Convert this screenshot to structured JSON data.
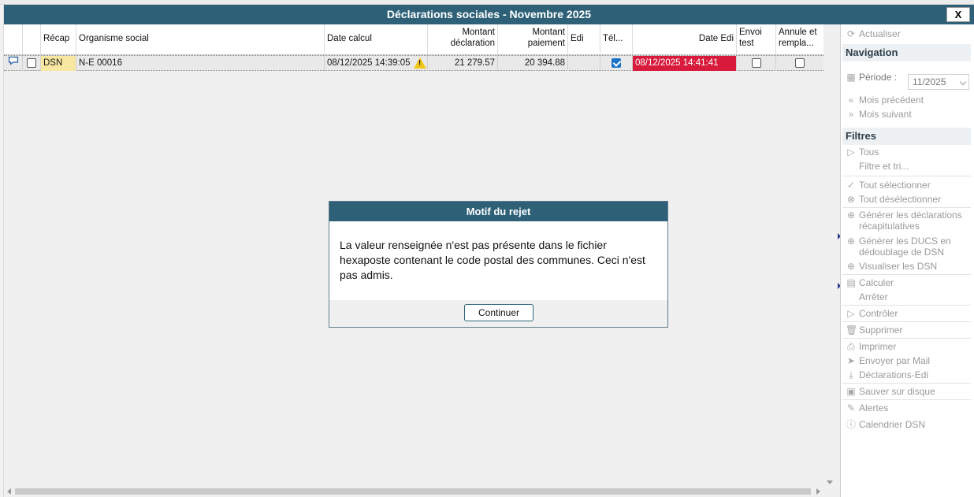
{
  "window": {
    "title": "Déclarations sociales - Novembre 2025",
    "close_label": "X"
  },
  "grid": {
    "headers": {
      "recap": "Récap",
      "organisme": "Organisme social",
      "date_calcul": "Date calcul",
      "montant_declaration_1": "Montant",
      "montant_declaration_2": "déclaration",
      "montant_paiement_1": "Montant",
      "montant_paiement_2": "paiement",
      "edi": "Edi",
      "tel": "Tél...",
      "date_edi": "Date Edi",
      "envoi_test_1": "Envoi",
      "envoi_test_2": "test",
      "annule_1": "Annule et",
      "annule_2": "rempla..."
    },
    "rows": [
      {
        "recap": "DSN",
        "organisme": "N-E  00016",
        "date_calcul": "08/12/2025 14:39:05",
        "montant_declaration": "21 279.57",
        "montant_paiement": "20 394.88",
        "edi": "",
        "date_edi": "08/12/2025 14:41:41"
      }
    ]
  },
  "colors": {
    "header_bg": "#2e6178",
    "date_edi_bg": "#d81b3c",
    "recap_bg": "#f7e7a1"
  },
  "side": {
    "actualiser": "Actualiser",
    "navigation": "Navigation",
    "periode_label": "Période :",
    "periode_value": "11/2025",
    "mois_precedent": "Mois précédent",
    "mois_suivant": "Mois suivant",
    "filtres": "Filtres",
    "tous": "Tous",
    "filtre_et_tri": "Filtre et tri...",
    "tout_selectionner": "Tout sélectionner",
    "tout_deselectionner": "Tout désélectionner",
    "generer_recap_1": "Générer les déclarations",
    "generer_recap_2": "récapitulatives",
    "generer_ducs_1": "Générer les DUCS en",
    "generer_ducs_2": "dédoublage de DSN",
    "visualiser_dsn": "Visualiser les DSN",
    "calculer": "Calculer",
    "arreter": "Arrêter",
    "controler": "Contrôler",
    "supprimer": "Supprimer",
    "imprimer": "Imprimer",
    "envoyer_mail": "Envoyer par Mail",
    "declarations_edi": "Déclarations-Edi",
    "sauver_disque": "Sauver sur disque",
    "alertes": "Alertes",
    "calendrier_dsn": "Calendrier DSN"
  },
  "modal": {
    "title": "Motif du rejet",
    "message": "La valeur renseignée n'est pas présente dans le fichier hexaposte contenant le code postal des communes. Ceci n'est pas admis.",
    "button": "Continuer"
  }
}
